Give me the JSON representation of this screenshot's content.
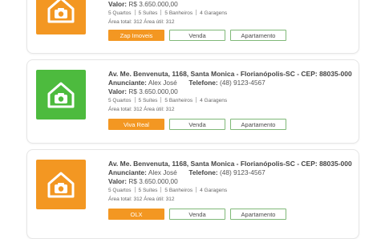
{
  "listings": [
    {
      "thumb_color": "#f39722",
      "value_label": "Valor:",
      "value": "R$ 3.650.000,00",
      "features": [
        "5 Quartos",
        "5 Suítes",
        "5 Banheiros",
        "4 Garagens"
      ],
      "area_label": "Área total:",
      "area_total": "312",
      "useful_label": "Área útil:",
      "area_useful": "312",
      "source": "Zap Imoveis",
      "type": "Venda",
      "category": "Apartamento"
    },
    {
      "thumb_color": "#4dbb3e",
      "address": "Av. Me. Benvenuta, 1168, Santa Monica - Florianópolis-SC - CEP: 88035-000",
      "agent_label": "Anunciante:",
      "agent": "Alex José",
      "phone_label": "Telefone:",
      "phone": "(48) 9123-4567",
      "value_label": "Valor:",
      "value": "R$ 3.650.000,00",
      "features": [
        "5 Quartos",
        "5 Suítes",
        "5 Banheiros",
        "4 Garagens"
      ],
      "area_label": "Área total:",
      "area_total": "312",
      "useful_label": "Área útil:",
      "area_useful": "312",
      "source": "Viva Real",
      "type": "Venda",
      "category": "Apartamento"
    },
    {
      "thumb_color": "#f39722",
      "address": "Av. Me. Benvenuta, 1168, Santa Monica - Florianópolis-SC - CEP: 88035-000",
      "agent_label": "Anunciante:",
      "agent": "Alex José",
      "phone_label": "Telefone:",
      "phone": "(48) 9123-4567",
      "value_label": "Valor:",
      "value": "R$ 3.650.000,00",
      "features": [
        "5 Quartos",
        "5 Suítes",
        "5 Banheiros",
        "4 Garagens"
      ],
      "area_label": "Área total:",
      "area_total": "312",
      "useful_label": "Área útil:",
      "area_useful": "312",
      "source": "OLX",
      "type": "Venda",
      "category": "Apartamento"
    }
  ],
  "icons": {
    "thumb": "house-camera-icon"
  }
}
